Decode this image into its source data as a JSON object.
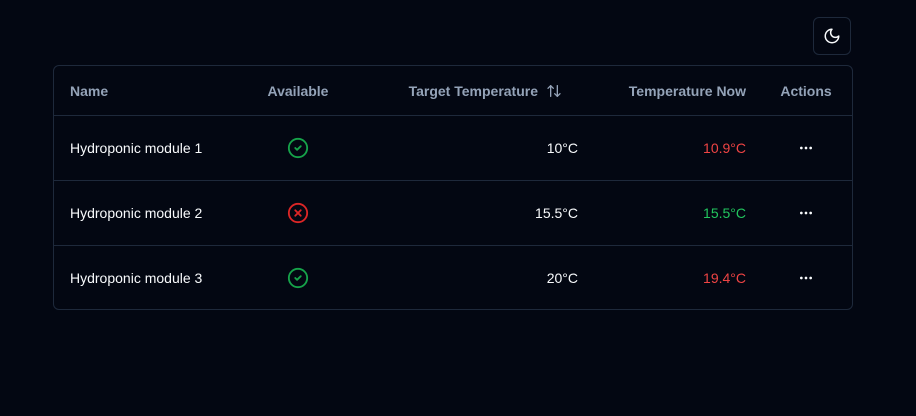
{
  "header": {
    "name": "Name",
    "available": "Available",
    "target_temperature": "Target Temperature",
    "temperature_now": "Temperature Now",
    "actions": "Actions"
  },
  "rows": [
    {
      "name": "Hydroponic module 1",
      "available": true,
      "target": "10°C",
      "now": "10.9°C",
      "now_status": "hot"
    },
    {
      "name": "Hydroponic module 2",
      "available": false,
      "target": "15.5°C",
      "now": "15.5°C",
      "now_status": "ok"
    },
    {
      "name": "Hydroponic module 3",
      "available": true,
      "target": "20°C",
      "now": "19.4°C",
      "now_status": "hot"
    }
  ],
  "colors": {
    "background": "#030712",
    "border": "#1e293b",
    "available": "#16a34a",
    "unavailable": "#dc2626",
    "temp_hot": "#ef4444",
    "temp_ok": "#22c55e"
  },
  "icons": {
    "theme_toggle": "moon-icon",
    "sort": "sort-arrows-icon",
    "available": "check-circle-icon",
    "unavailable": "x-circle-icon",
    "actions": "more-horizontal-icon"
  }
}
